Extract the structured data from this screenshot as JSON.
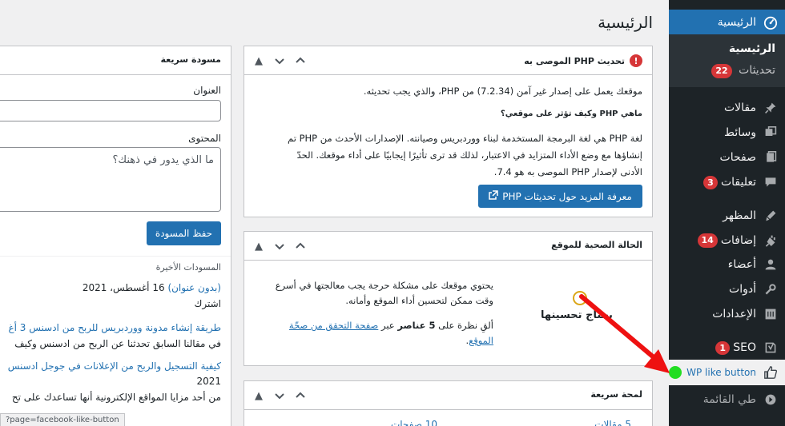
{
  "page": {
    "title": "الرئيسية"
  },
  "sidebar": {
    "dashboard": "الرئيسية",
    "home": "الرئيسية",
    "updates": "تحديثات",
    "updates_count": "22",
    "posts": "مقالات",
    "media": "وسائط",
    "pages": "صفحات",
    "comments": "تعليقات",
    "comments_count": "3",
    "appearance": "المظهر",
    "plugins": "إضافات",
    "plugins_count": "14",
    "users": "أعضاء",
    "tools": "أدوات",
    "settings": "الإعدادات",
    "seo": "SEO",
    "seo_count": "1",
    "wplike": "WP like button",
    "collapse": "طي القائمة"
  },
  "php_box": {
    "title": "تحديث PHP الموصى به",
    "line1": "موقعك يعمل على إصدار غير آمن (7.2.34) من PHP، والذي يجب تحديثه.",
    "question": "ماهي PHP وكيف تؤثر على موقعي؟",
    "desc1": "لغة PHP هي لغة البرمجة المستخدمة لبناء ووردبريس وصيانته. الإصدارات الأحدث من PHP تم",
    "desc2": "إنشاؤها مع وضع الأداء المتزايد في الاعتبار، لذلك قد ترى تأثيرًا إيجابيًا على أداء موقعك. الحدّ",
    "desc3": "الأدنى لإصدار PHP الموصى به هو 7.4.",
    "button": "معرفة المزيد حول تحديثات PHP"
  },
  "health_box": {
    "title": "الحالة الصحية للموقع",
    "status": "يحتاج تحسينها",
    "p1": "يحتوي موقعك على مشكلة حرجة يجب معالجتها في أسرع وقت ممكن لتحسين أداء الموقع وأمانه.",
    "p2_pre": "ألقِ نظرة على",
    "p2_count": "5 عناصر",
    "p2_mid": "عبر",
    "p2_link": "صفحة التحقق من صحّة الموقع",
    "p2_end": "."
  },
  "glance_box": {
    "title": "لمحة سريعة",
    "posts": "5 مقالات",
    "pages": "10 صفحات"
  },
  "draft_box": {
    "title": "مسودة سريعة",
    "title_label": "العنوان",
    "content_label": "المحتوى",
    "content_placeholder": "ما الذي يدور في ذهنك؟",
    "save_button": "حفظ المسودة",
    "recent_label": "المسودات الأخيرة",
    "d1_title": "(بدون عنوان)",
    "d1_date": "16 أغسطس، 2021",
    "d1_excerpt": "اشترك",
    "d2_title": "طريقة إنشاء مدونة ووردبريس للربح من ادسنس 3 أغ",
    "d2_excerpt": "في مقالنا السابق تحدثنا عن الربح من ادسنس وكيف",
    "d3_title": "كيفية التسجيل والربح من الإعلانات في جوجل ادسنس",
    "d3_date": "2021",
    "d3_excerpt": "من أحد مزايا المواقع الإلكترونية أنها تساعدك على تح"
  },
  "status_url": "?page=facebook-like-button",
  "colors": {
    "accent": "#2271b1",
    "sidebar": "#1d2327",
    "badge": "#d63638"
  }
}
